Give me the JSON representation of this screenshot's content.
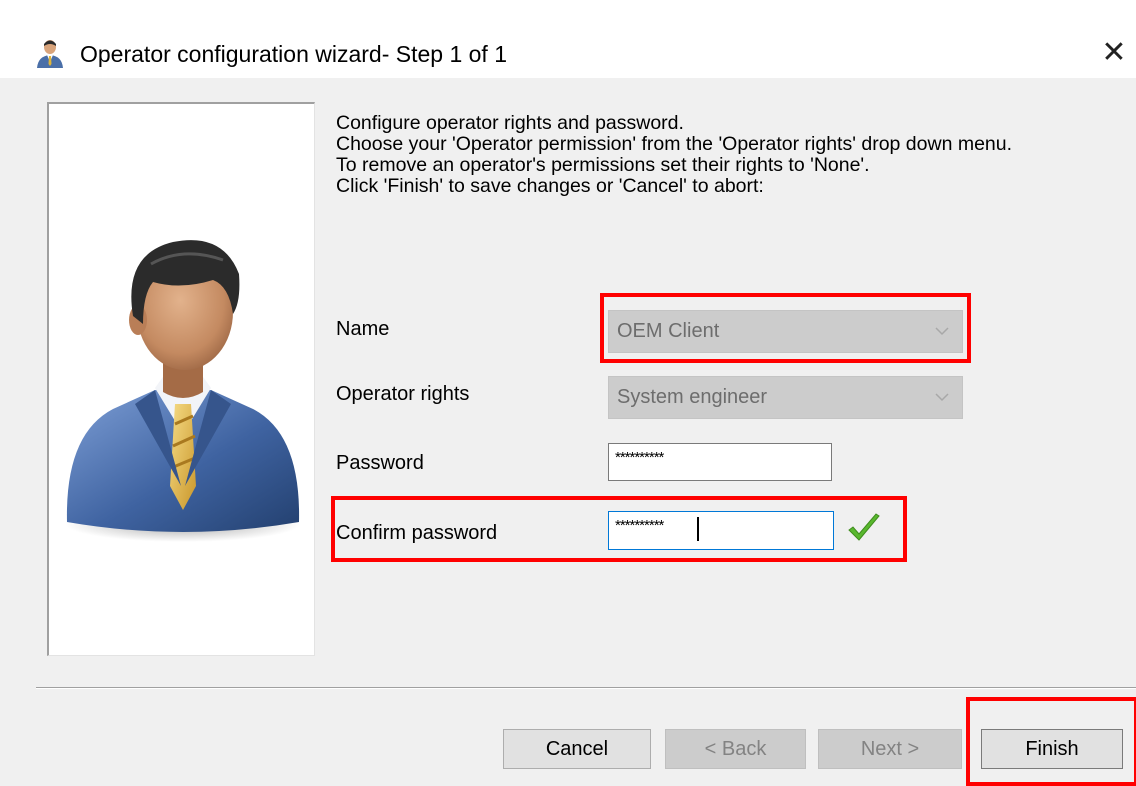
{
  "window": {
    "title": "Operator configuration wizard- Step 1 of 1",
    "close_symbol": "✕"
  },
  "instructions": {
    "lines": [
      "Configure operator rights and password.",
      "Choose your 'Operator permission' from the 'Operator rights' drop down menu.",
      "To remove an operator's permissions set their rights to 'None'.",
      "Click 'Finish' to save changes or 'Cancel' to abort:"
    ]
  },
  "form": {
    "name_label": "Name",
    "name_value": "OEM Client",
    "rights_label": "Operator rights",
    "rights_value": "System engineer",
    "password_label": "Password",
    "password_value": "**********",
    "confirm_label": "Confirm password",
    "confirm_value": "**********"
  },
  "buttons": {
    "cancel": "Cancel",
    "back": "< Back",
    "next": "Next >",
    "finish": "Finish"
  },
  "icons": {
    "title": "user-icon",
    "avatar": "operator-avatar-icon",
    "close": "close-icon",
    "dropdown": "chevron-down-icon",
    "valid": "checkmark-icon"
  },
  "colors": {
    "highlight": "#ff0000",
    "focus_border": "#0078d7",
    "check": "#59b82e",
    "suit": "#4a6fa8",
    "tie": "#e0b53a"
  }
}
